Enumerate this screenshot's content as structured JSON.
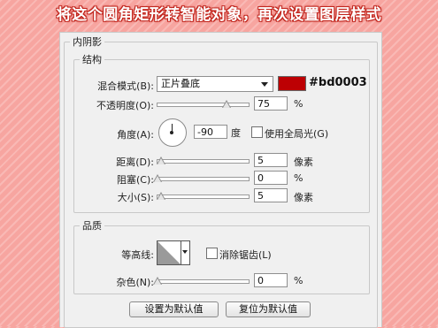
{
  "headline": "将这个圆角矩形转智能对象，再次设置图层样式",
  "panel": {
    "title": "内阴影",
    "structure": {
      "legend": "结构",
      "blend_mode": {
        "label": "混合模式(B):",
        "value": "正片叠底",
        "color": "#bd0003",
        "color_text": "#bd0003"
      },
      "opacity": {
        "label": "不透明度(O):",
        "value": "75",
        "unit": "%",
        "fraction": 0.75
      },
      "angle": {
        "label": "角度(A):",
        "value": "-90",
        "unit": "度",
        "global_light_label": "使用全局光(G)",
        "global_light_checked": false
      },
      "distance": {
        "label": "距离(D):",
        "value": "5",
        "unit": "像素",
        "fraction": 0.02
      },
      "choke": {
        "label": "阻塞(C):",
        "value": "0",
        "unit": "%",
        "fraction": 0.0
      },
      "size": {
        "label": "大小(S):",
        "value": "5",
        "unit": "像素",
        "fraction": 0.02
      }
    },
    "quality": {
      "legend": "品质",
      "contour": {
        "label": "等高线:",
        "antialias_label": "消除锯齿(L)",
        "antialias_checked": false
      },
      "noise": {
        "label": "杂色(N):",
        "value": "0",
        "unit": "%",
        "fraction": 0.0
      }
    },
    "buttons": {
      "make_default": "设置为默认值",
      "reset_default": "复位为默认值"
    }
  }
}
